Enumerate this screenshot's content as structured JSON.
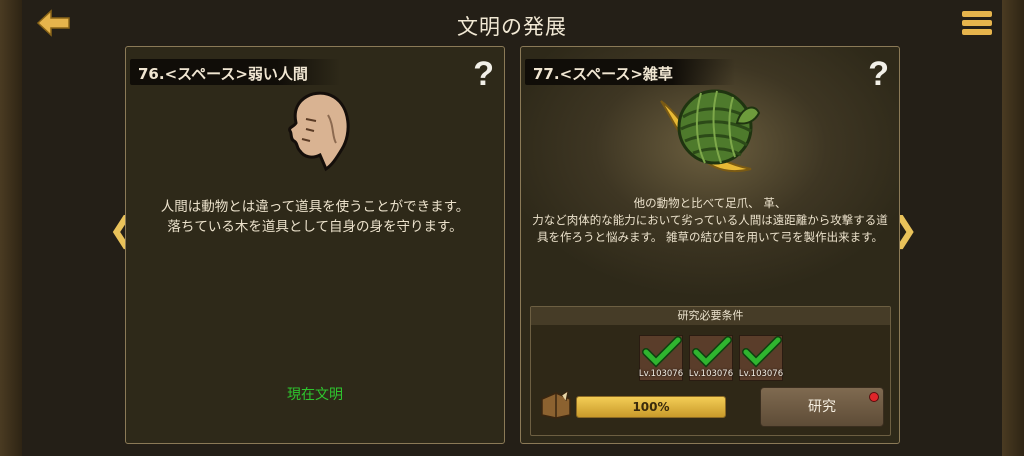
{
  "header": {
    "title": "文明の発展",
    "back_icon": "back-arrow-icon",
    "menu_icon": "hamburger-menu-icon"
  },
  "left_card": {
    "title": "76.<スペース>弱い人間",
    "help": "?",
    "icon": "bald-human-head-icon",
    "description_lines": [
      "人間は動物とは違って道具を使うことができます。",
      "落ちている木を道具として自身の身を守ります。"
    ],
    "status": "現在文明"
  },
  "right_card": {
    "title": "77.<スペース>雑草",
    "help": "?",
    "icon": "grass-rope-ball-icon",
    "description_lines": [
      "他の動物と比べて足爪、 革、",
      "力など肉体的な能力において劣っている人間は遠距離から攻撃する道",
      "具を作ろうと悩みます。 雑草の結び目を用いて弓を製作出来ます。"
    ],
    "requirements": {
      "header": "研究必要条件",
      "items": [
        {
          "level": "Lv.103076",
          "status": "check-mark-icon"
        },
        {
          "level": "Lv.103076",
          "status": "check-mark-icon"
        },
        {
          "level": "Lv.103076",
          "status": "check-mark-icon"
        }
      ],
      "progress_percent": 100,
      "progress_label": "100%",
      "research_button": "研究"
    }
  },
  "nav": {
    "prev": "❮",
    "next": "❯"
  },
  "colors": {
    "accent_gold": "#e9c25a",
    "status_green": "#2ec52e",
    "check_green": "#2fb52f"
  }
}
